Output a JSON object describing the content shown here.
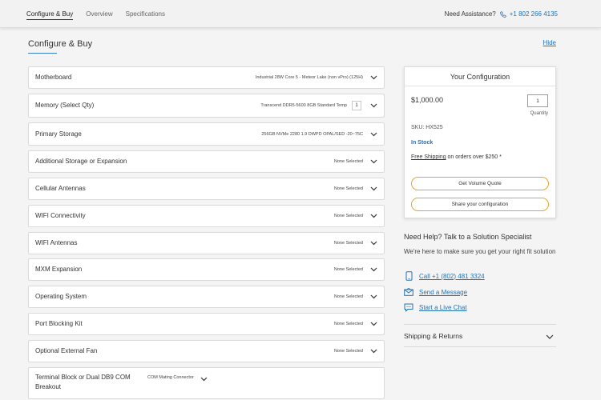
{
  "nav": {
    "tabs": [
      {
        "label": "Configure & Buy"
      },
      {
        "label": "Overview"
      },
      {
        "label": "Specifications"
      }
    ],
    "assist_label": "Need Assistance?",
    "phone": "+1 802 266 4135",
    "phone_icon": "phone-icon"
  },
  "page": {
    "title": "Configure & Buy",
    "hide_label": "Hide"
  },
  "options": [
    {
      "label": "Motherboard",
      "value": "Industrial 28W Core 5 - Meteor Lake (non vPro) (125H)"
    },
    {
      "label": "Memory (Select Qty)",
      "value": "Transcend DDR5-5600 8GB Standard Temp",
      "qty": "1"
    },
    {
      "label": "Primary Storage",
      "value": "256GB NVMe 2280 1.9 DWPD OPAL/SED -20~75C"
    },
    {
      "label": "Additional Storage or Expansion",
      "value": "None Selected"
    },
    {
      "label": "Cellular Antennas",
      "value": "None Selected"
    },
    {
      "label": "WIFI Connectivity",
      "value": "None Selected"
    },
    {
      "label": "WIFI Antennas",
      "value": "None Selected"
    },
    {
      "label": "MXM Expansion",
      "value": "None Selected"
    },
    {
      "label": "Operating System",
      "value": "None Selected"
    },
    {
      "label": "Port Blocking Kit",
      "value": "None Selected"
    },
    {
      "label": "Optional External Fan",
      "value": "None Selected"
    },
    {
      "label": "Terminal Block or Dual DB9 COM Breakout",
      "value": "COM Mating Connector"
    }
  ],
  "config": {
    "title": "Your Configuration",
    "price": "$1,000.00",
    "quantity": "1",
    "quantity_label": "Quantity",
    "sku": "SKU: HX525",
    "stock": "In Stock",
    "free_shipping": "Free Shipping",
    "shipping_rest": " on orders over $250 *",
    "volume_quote": "Get Volume Quote",
    "share": "Share your configuration"
  },
  "help": {
    "title": "Need Help? Talk to a Solution Specialist",
    "subtitle": "We're here to make sure you get your right fit solution",
    "call": "Call +1 (802) 481 3324",
    "message": "Send a Message",
    "chat": "Start a Live Chat"
  },
  "shipping_returns": "Shipping & Returns",
  "colors": {
    "accent": "#2471b5",
    "button_border": "#e3a33b"
  }
}
